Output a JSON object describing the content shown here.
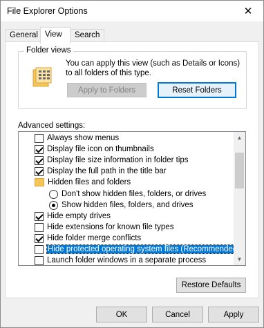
{
  "window": {
    "title": "File Explorer Options",
    "close_glyph": "✕"
  },
  "tabs": [
    {
      "label": "General",
      "active": false
    },
    {
      "label": "View",
      "active": true
    },
    {
      "label": "Search",
      "active": false
    }
  ],
  "folder_views": {
    "title": "Folder views",
    "description": "You can apply this view (such as Details or Icons) to all folders of this type.",
    "apply_button": "Apply to Folders",
    "reset_button": "Reset Folders",
    "icon": "folder-grid-icon"
  },
  "advanced": {
    "label": "Advanced settings:",
    "items": [
      {
        "type": "checkbox",
        "checked": false,
        "label": "Always show menus",
        "indent": 1
      },
      {
        "type": "checkbox",
        "checked": true,
        "label": "Display file icon on thumbnails",
        "indent": 1
      },
      {
        "type": "checkbox",
        "checked": true,
        "label": "Display file size information in folder tips",
        "indent": 1
      },
      {
        "type": "checkbox",
        "checked": true,
        "label": "Display the full path in the title bar",
        "indent": 1
      },
      {
        "type": "folder",
        "label": "Hidden files and folders",
        "indent": 1
      },
      {
        "type": "radio",
        "checked": false,
        "label": "Don't show hidden files, folders, or drives",
        "indent": 2
      },
      {
        "type": "radio",
        "checked": true,
        "label": "Show hidden files, folders, and drives",
        "indent": 2
      },
      {
        "type": "checkbox",
        "checked": true,
        "label": "Hide empty drives",
        "indent": 1
      },
      {
        "type": "checkbox",
        "checked": false,
        "label": "Hide extensions for known file types",
        "indent": 1
      },
      {
        "type": "checkbox",
        "checked": true,
        "label": "Hide folder merge conflicts",
        "indent": 1
      },
      {
        "type": "checkbox",
        "checked": false,
        "label": "Hide protected operating system files (Recommended)",
        "indent": 1,
        "selected": true
      },
      {
        "type": "checkbox",
        "checked": false,
        "label": "Launch folder windows in a separate process",
        "indent": 1
      }
    ]
  },
  "restore_defaults": "Restore Defaults",
  "footer": {
    "ok": "OK",
    "cancel": "Cancel",
    "apply": "Apply"
  }
}
